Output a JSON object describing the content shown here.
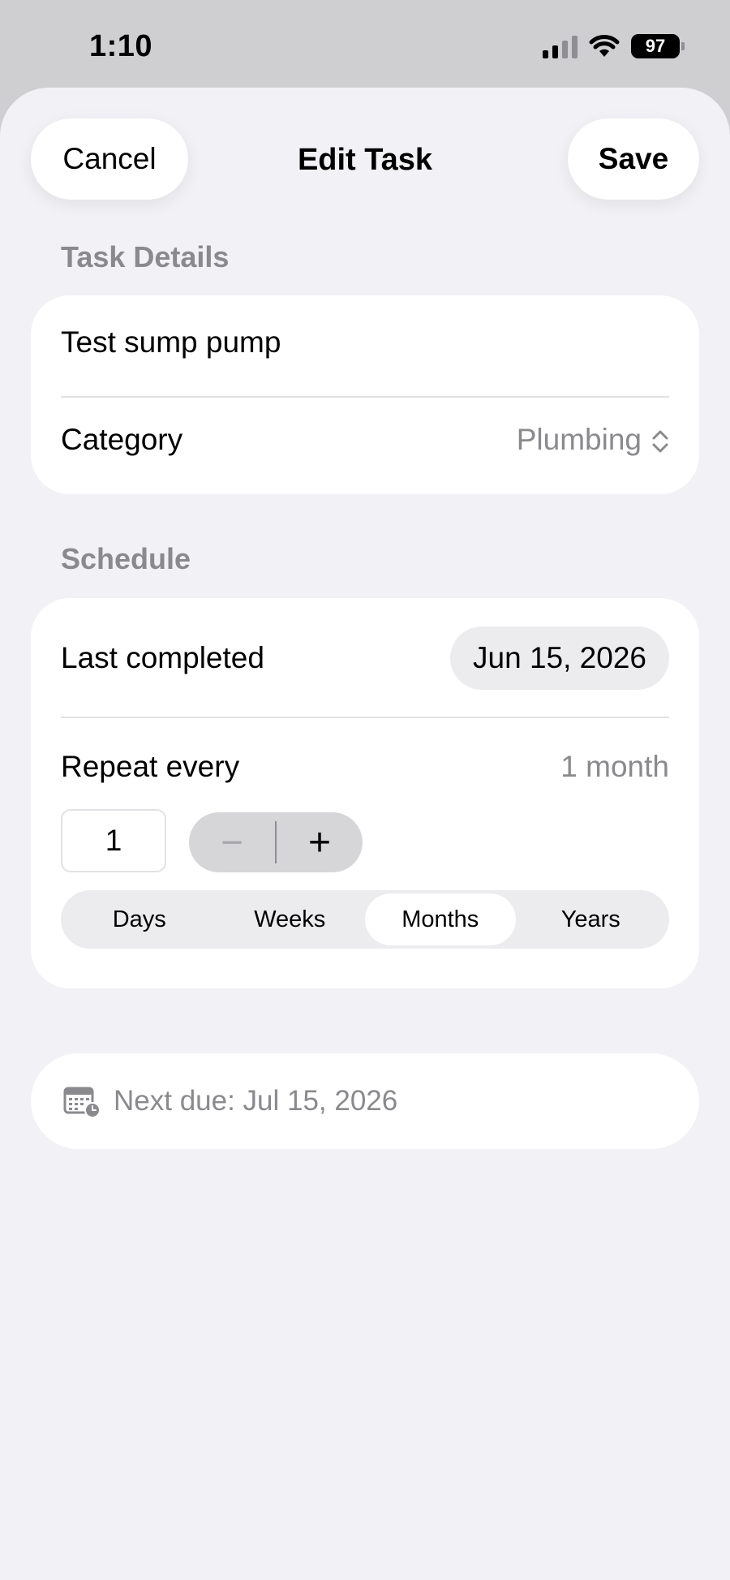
{
  "status_bar": {
    "time": "1:10",
    "battery": "97",
    "icons": [
      "signal-icon",
      "wifi-icon",
      "battery-icon"
    ]
  },
  "nav": {
    "cancel_label": "Cancel",
    "title": "Edit Task",
    "save_label": "Save"
  },
  "task_details": {
    "header": "Task Details",
    "task_name": "Test sump pump",
    "category_label": "Category",
    "category_value": "Plumbing",
    "category_icon": "chevron-up-down-icon"
  },
  "schedule": {
    "header": "Schedule",
    "last_completed_label": "Last completed",
    "last_completed_value": "Jun 15, 2026",
    "repeat_label": "Repeat every",
    "repeat_summary": "1 month",
    "repeat_count": "1",
    "stepper_minus": "−",
    "stepper_plus": "+",
    "units": [
      "Days",
      "Weeks",
      "Months",
      "Years"
    ],
    "selected_unit": "Months"
  },
  "next_due": {
    "icon": "calendar-clock-icon",
    "text": "Next due: Jul 15, 2026"
  },
  "colors": {
    "sheet_background": "#f1f1f6",
    "secondary_text": "#8a8a8e",
    "card_background": "#ffffff"
  }
}
